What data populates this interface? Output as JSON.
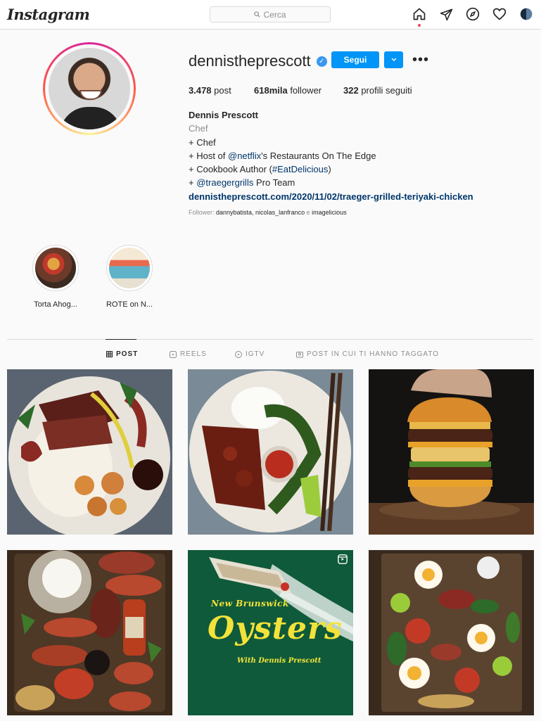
{
  "app": {
    "logo": "Instagram"
  },
  "search": {
    "placeholder": "Cerca",
    "icon": "search-icon"
  },
  "nav": {
    "icons": [
      "home-icon",
      "direct-icon",
      "explore-icon",
      "activity-icon",
      "profile-avatar"
    ]
  },
  "profile": {
    "username": "dennistheprescott",
    "verified": true,
    "follow_label": "Segui",
    "posts_count": "3.478",
    "posts_label": "post",
    "followers_count": "618mila",
    "followers_label": "follower",
    "following_count": "322",
    "following_label": "profili seguiti",
    "full_name": "Dennis Prescott",
    "category": "Chef",
    "bio": {
      "line1": "+ Chef",
      "line2_pre": "+ Host of ",
      "line2_link": "@netflix",
      "line2_post": "'s Restaurants On The Edge",
      "line3_pre": "+ Cookbook Author (",
      "line3_link": "#EatDelicious",
      "line3_post": ")",
      "line4_pre": "+ ",
      "line4_link": "@traegergrills",
      "line4_post": " Pro Team",
      "website": "dennistheprescott.com/2020/11/02/traeger-grilled-teriyaki-chicken"
    },
    "followed_by": {
      "prefix": "Follower: ",
      "names": "dannybatista, nicolas_lanfranco",
      "joiner": " e ",
      "last": "imagelicious"
    }
  },
  "highlights": [
    {
      "label": "Torta Ahog..."
    },
    {
      "label": "ROTE on N..."
    }
  ],
  "tabs": [
    {
      "label": "POST",
      "icon": "grid-icon",
      "active": true
    },
    {
      "label": "REELS",
      "icon": "reels-icon",
      "active": false
    },
    {
      "label": "IGTV",
      "icon": "igtv-icon",
      "active": false
    },
    {
      "label": "POST IN CUI TI HANNO TAGGATO",
      "icon": "tagged-icon",
      "active": false
    }
  ],
  "posts": [
    {
      "alt": "steak-octopus-shrimp-plate"
    },
    {
      "alt": "teriyaki-chicken-rice-plate"
    },
    {
      "alt": "double-cheeseburger"
    },
    {
      "alt": "bruschetta-platter"
    },
    {
      "alt": "oysters-video-thumbnail",
      "text_top": "New Brunswick",
      "text_main": "Oysters",
      "text_bottom": "With Dennis Prescott"
    },
    {
      "alt": "breakfast-board"
    }
  ],
  "colors": {
    "accent": "#0095f6",
    "link": "#00376b",
    "muted": "#8e8e8e",
    "verified": "#3897f0"
  }
}
